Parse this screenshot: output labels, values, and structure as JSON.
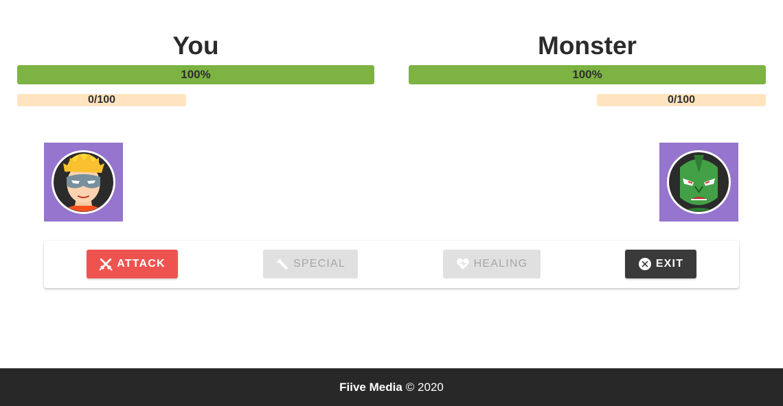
{
  "player": {
    "name": "You",
    "health_label": "100%",
    "health_fraction": 1.0,
    "special_label": "0/100",
    "special_fraction": 0,
    "avatar_icon": "masked-hero-icon"
  },
  "monster": {
    "name": "Monster",
    "health_label": "100%",
    "health_fraction": 1.0,
    "special_label": "0/100",
    "special_fraction": 0,
    "avatar_icon": "green-monster-icon"
  },
  "actions": {
    "attack": {
      "label": "Attack",
      "icon": "crossed-swords-icon",
      "enabled": true
    },
    "special": {
      "label": "Special",
      "icon": "special-attack-icon",
      "enabled": false
    },
    "healing": {
      "label": "Healing",
      "icon": "heart-icon",
      "enabled": false
    },
    "exit": {
      "label": "Exit",
      "icon": "close-circle-icon",
      "enabled": true
    }
  },
  "footer": {
    "brand": "Fiive Media",
    "copyright": "© 2020"
  },
  "colors": {
    "health": "#7cb342",
    "special_track": "#ffe4bf",
    "avatar_bg": "#9575cd",
    "attack": "#ef5350",
    "disabled": "#e0e0e0",
    "exit": "#3a3a3a",
    "footer": "#282828"
  }
}
